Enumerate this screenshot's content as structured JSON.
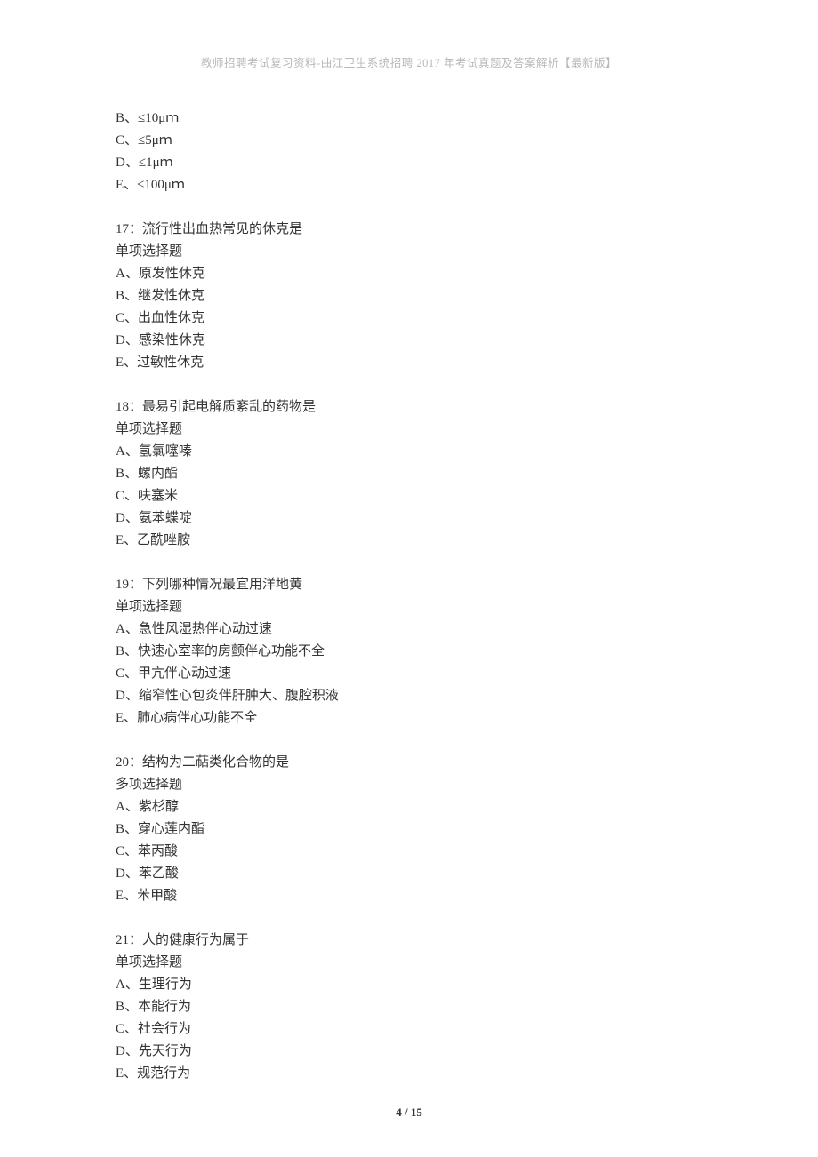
{
  "header": "教师招聘考试复习资料-曲江卫生系统招聘 2017 年考试真题及答案解析【最新版】",
  "blocks": [
    {
      "lines": [
        "B、≤10μｍ",
        "C、≤5μｍ",
        "D、≤1μｍ",
        "E、≤100μｍ"
      ]
    },
    {
      "lines": [
        "17：流行性出血热常见的休克是",
        "单项选择题",
        "A、原发性休克",
        "B、继发性休克",
        "C、出血性休克",
        "D、感染性休克",
        "E、过敏性休克"
      ]
    },
    {
      "lines": [
        "18：最易引起电解质紊乱的药物是",
        "单项选择题",
        "A、氢氯噻嗪",
        "B、螺内酯",
        "C、呋塞米",
        "D、氨苯蝶啶",
        "E、乙酰唑胺"
      ]
    },
    {
      "lines": [
        "19：下列哪种情况最宜用洋地黄",
        "单项选择题",
        "A、急性风湿热伴心动过速",
        "B、快速心室率的房颤伴心功能不全",
        "C、甲亢伴心动过速",
        "D、缩窄性心包炎伴肝肿大、腹腔积液",
        "E、肺心病伴心功能不全"
      ]
    },
    {
      "lines": [
        "20：结构为二萜类化合物的是",
        "多项选择题",
        "A、紫杉醇",
        "B、穿心莲内酯",
        "C、苯丙酸",
        "D、苯乙酸",
        "E、苯甲酸"
      ]
    },
    {
      "lines": [
        "21：人的健康行为属于",
        "单项选择题",
        "A、生理行为",
        "B、本能行为",
        "C、社会行为",
        "D、先天行为",
        "E、规范行为"
      ]
    }
  ],
  "footer": {
    "current": "4",
    "sep": " / ",
    "total": "15"
  }
}
